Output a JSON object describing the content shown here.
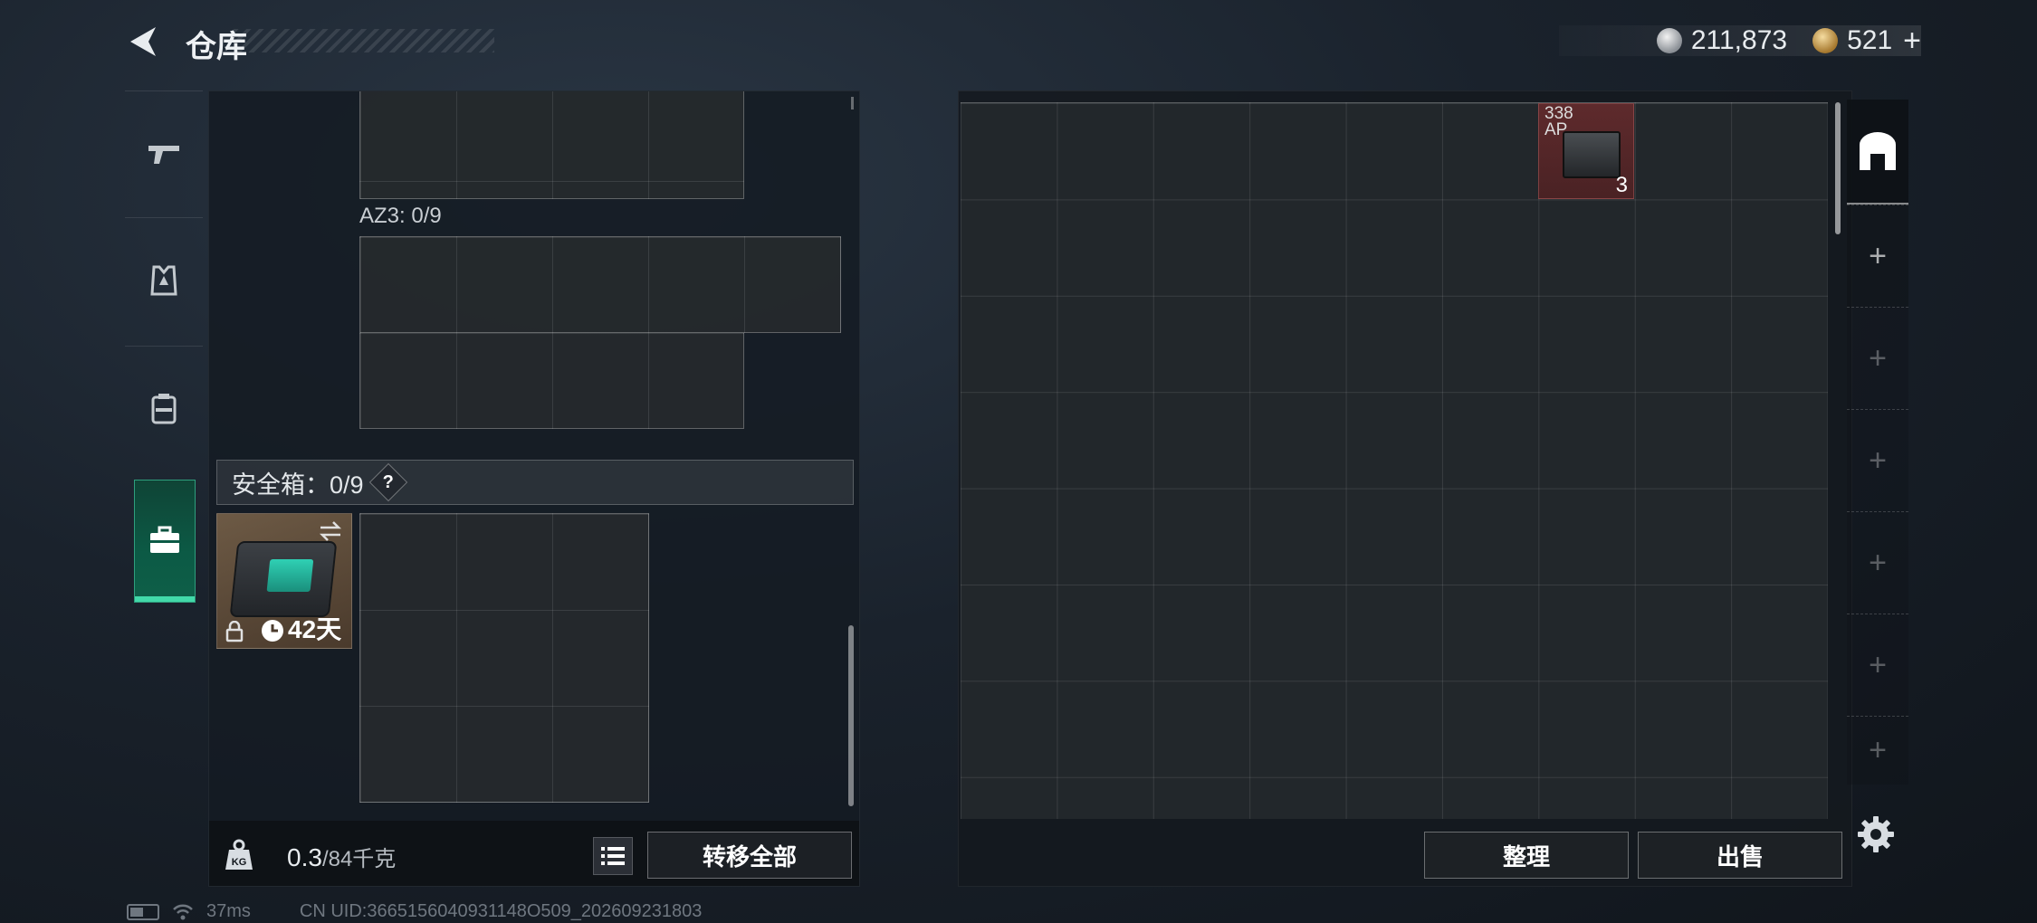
{
  "header": {
    "title": "仓库",
    "silver_amount": "211,873",
    "gold_amount": "521",
    "gold_plus": "+"
  },
  "side_tabs": [
    {
      "name": "weapons",
      "icon": "pistol-icon"
    },
    {
      "name": "armor",
      "icon": "armor-vest-icon"
    },
    {
      "name": "backpack",
      "icon": "backpack-icon"
    },
    {
      "name": "safe-box",
      "icon": "briefcase-icon",
      "active": true
    }
  ],
  "loadout": {
    "az3_label": "AZ3: 0/9",
    "safe_box_label": "安全箱：0/9",
    "help_symbol": "?",
    "safe_box_item": {
      "days_left": "42天",
      "icons": [
        "swap-icon",
        "lock-icon",
        "clock-icon"
      ]
    },
    "weight_current": "0.3",
    "weight_max": "/84千克",
    "transfer_all_label": "转移全部"
  },
  "stash": {
    "item": {
      "name_line1": "338",
      "name_line2": "AP",
      "count": "3",
      "bg_color": "#5e2a2c"
    },
    "sort_label": "整理",
    "sell_label": "出售",
    "tab_add_symbol": "+"
  },
  "status": {
    "ping": "37ms",
    "uid": "CN UID:3665156040931148O509_202609231803"
  },
  "colors": {
    "active_tab": "#0c5a45",
    "active_accent": "#42d9a9",
    "ammo_bg": "#5e2a2c"
  }
}
